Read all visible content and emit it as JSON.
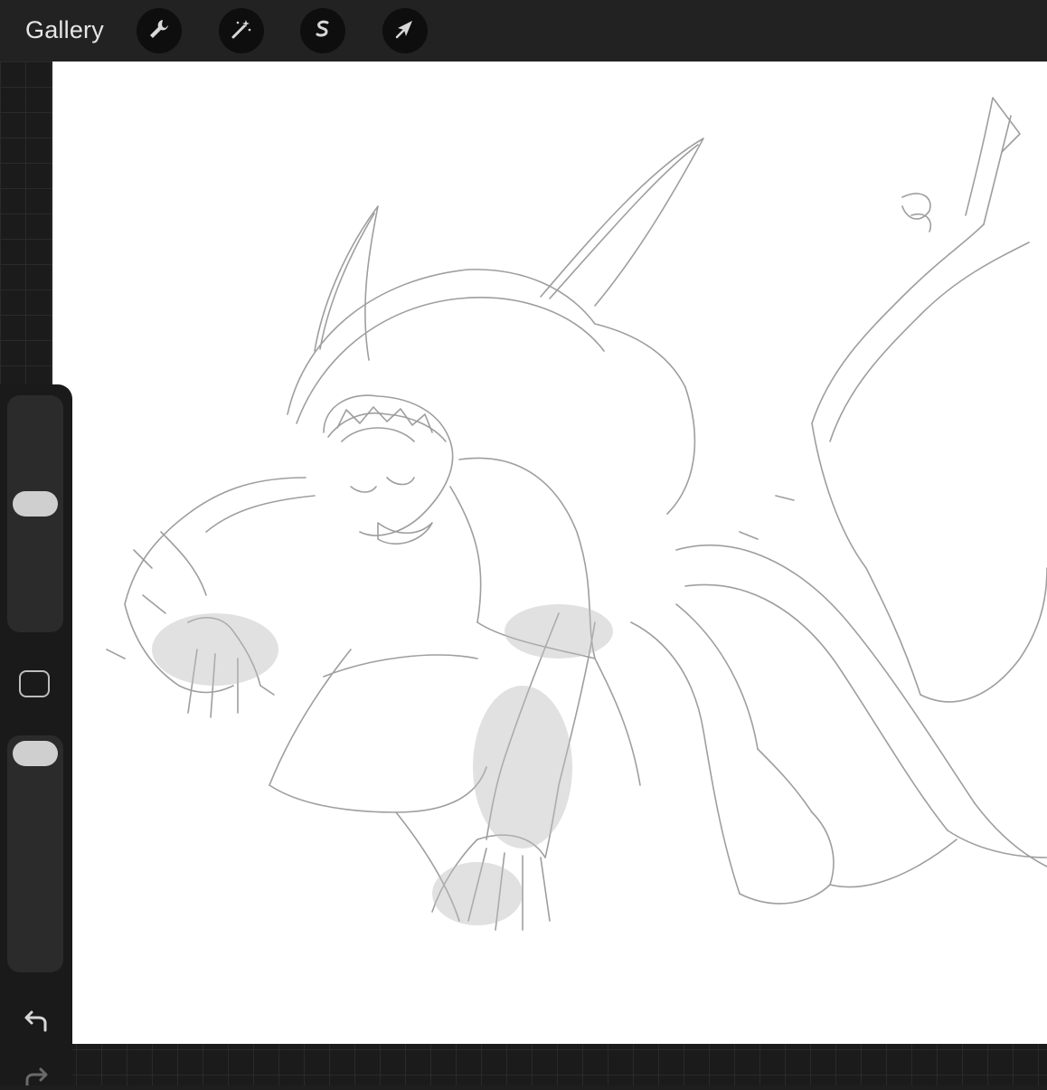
{
  "topbar": {
    "gallery_label": "Gallery",
    "tools": [
      {
        "name": "actions",
        "icon": "wrench-icon"
      },
      {
        "name": "adjustments",
        "icon": "magic-wand-icon"
      },
      {
        "name": "selection",
        "icon": "selection-s-icon"
      },
      {
        "name": "transform",
        "icon": "arrow-cursor-icon"
      }
    ]
  },
  "sidebar": {
    "brush_size_level": 0.45,
    "opacity_level": 0.0,
    "controls": [
      "brush-size-slider",
      "modify-button",
      "opacity-slider",
      "undo-button",
      "redo-button"
    ]
  },
  "colors": {
    "topbar": "#222222",
    "canvas": "#ffffff",
    "sidebar": "#1a1a1a",
    "slider_thumb": "#cfcfcf",
    "sketch_stroke": "#8a8a8a"
  }
}
